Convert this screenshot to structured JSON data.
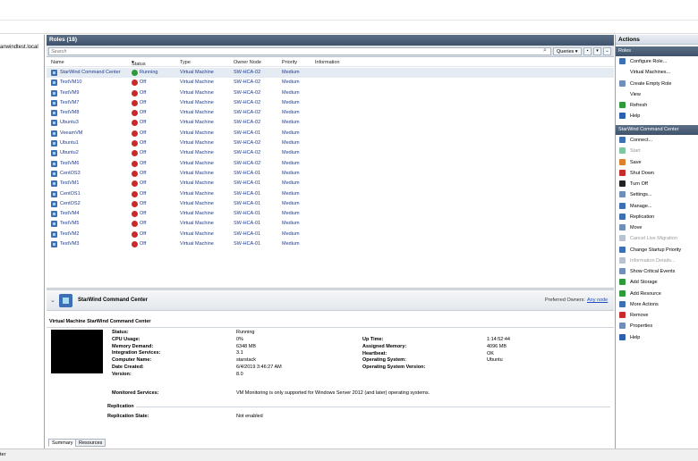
{
  "left": {
    "tree_text": "anwindtest.local"
  },
  "roles": {
    "header": "Roles (18)",
    "search_placeholder": "Search",
    "queries_label": "Queries",
    "columns": [
      "Name",
      "Status",
      "Type",
      "Owner Node",
      "Priority",
      "Information"
    ],
    "rows": [
      {
        "name": "StarWind Command Center",
        "status": "Running",
        "type": "Virtual Machine",
        "owner": "SW-HCA-02",
        "priority": "Medium",
        "state": "run"
      },
      {
        "name": "TestVM10",
        "status": "Off",
        "type": "Virtual Machine",
        "owner": "SW-HCA-02",
        "priority": "Medium",
        "state": "off"
      },
      {
        "name": "TestVM9",
        "status": "Off",
        "type": "Virtual Machine",
        "owner": "SW-HCA-02",
        "priority": "Medium",
        "state": "off"
      },
      {
        "name": "TestVM7",
        "status": "Off",
        "type": "Virtual Machine",
        "owner": "SW-HCA-02",
        "priority": "Medium",
        "state": "off"
      },
      {
        "name": "TestVM8",
        "status": "Off",
        "type": "Virtual Machine",
        "owner": "SW-HCA-02",
        "priority": "Medium",
        "state": "off"
      },
      {
        "name": "Ubuntu3",
        "status": "Off",
        "type": "Virtual Machine",
        "owner": "SW-HCA-02",
        "priority": "Medium",
        "state": "off"
      },
      {
        "name": "VeeamVM",
        "status": "Off",
        "type": "Virtual Machine",
        "owner": "SW-HCA-01",
        "priority": "Medium",
        "state": "off"
      },
      {
        "name": "Ubuntu1",
        "status": "Off",
        "type": "Virtual Machine",
        "owner": "SW-HCA-02",
        "priority": "Medium",
        "state": "off"
      },
      {
        "name": "Ubuntu2",
        "status": "Off",
        "type": "Virtual Machine",
        "owner": "SW-HCA-02",
        "priority": "Medium",
        "state": "off"
      },
      {
        "name": "TestVM6",
        "status": "Off",
        "type": "Virtual Machine",
        "owner": "SW-HCA-02",
        "priority": "Medium",
        "state": "off"
      },
      {
        "name": "CentOS3",
        "status": "Off",
        "type": "Virtual Machine",
        "owner": "SW-HCA-01",
        "priority": "Medium",
        "state": "off"
      },
      {
        "name": "TestVM1",
        "status": "Off",
        "type": "Virtual Machine",
        "owner": "SW-HCA-01",
        "priority": "Medium",
        "state": "off"
      },
      {
        "name": "CentOS1",
        "status": "Off",
        "type": "Virtual Machine",
        "owner": "SW-HCA-01",
        "priority": "Medium",
        "state": "off"
      },
      {
        "name": "CentOS2",
        "status": "Off",
        "type": "Virtual Machine",
        "owner": "SW-HCA-01",
        "priority": "Medium",
        "state": "off"
      },
      {
        "name": "TestVM4",
        "status": "Off",
        "type": "Virtual Machine",
        "owner": "SW-HCA-01",
        "priority": "Medium",
        "state": "off"
      },
      {
        "name": "TestVM5",
        "status": "Off",
        "type": "Virtual Machine",
        "owner": "SW-HCA-01",
        "priority": "Medium",
        "state": "off"
      },
      {
        "name": "TestVM2",
        "status": "Off",
        "type": "Virtual Machine",
        "owner": "SW-HCA-01",
        "priority": "Medium",
        "state": "off"
      },
      {
        "name": "TestVM3",
        "status": "Off",
        "type": "Virtual Machine",
        "owner": "SW-HCA-01",
        "priority": "Medium",
        "state": "off"
      }
    ]
  },
  "details": {
    "title": "StarWind Command Center",
    "preferred_owners_label": "Preferred Owners:",
    "preferred_owners_link": "Any node",
    "vm_title": "Virtual Machine StarWind Command Center",
    "left_fields": [
      {
        "label": "Status:",
        "value": "Running"
      },
      {
        "label": "CPU Usage:",
        "value": "0%"
      },
      {
        "label": "Memory Demand:",
        "value": "6348 MB"
      },
      {
        "label": "Integration Services:",
        "value": "3.1"
      },
      {
        "label": "Computer Name:",
        "value": "starstack"
      },
      {
        "label": "Date Created:",
        "value": "6/4/2019 3:46:27 AM"
      },
      {
        "label": "Version:",
        "value": "8.0"
      }
    ],
    "right_fields": [
      {
        "label": "Up Time:",
        "value": "1:14:52:44"
      },
      {
        "label": "Assigned Memory:",
        "value": "4096 MB"
      },
      {
        "label": "Heartbeat:",
        "value": "OK"
      },
      {
        "label": "Operating System:",
        "value": "Ubuntu"
      },
      {
        "label": "Operating System Version:",
        "value": ""
      }
    ],
    "monitored_label": "Monitored Services:",
    "monitored_value": "VM Monitoring is only supported for Windows Server 2012 (and later) operating systems.",
    "replication_label": "Replication",
    "replication_state_label": "Replication State:",
    "replication_state_value": "Not enabled",
    "tabs": [
      "Summary",
      "Resources"
    ]
  },
  "actions": {
    "header": "Actions",
    "section1": "Roles",
    "section1_items": [
      {
        "label": "Configure Role...",
        "icon": "configure-role-icon",
        "color": "#3c6fb3",
        "disabled": false
      },
      {
        "label": "Virtual Machines...",
        "icon": "",
        "color": "",
        "disabled": false
      },
      {
        "label": "Create Empty Role",
        "icon": "create-role-icon",
        "color": "#6f8fb8",
        "disabled": false
      },
      {
        "label": "View",
        "icon": "",
        "color": "",
        "disabled": false
      },
      {
        "label": "Refresh",
        "icon": "refresh-icon",
        "color": "#2e9b3a",
        "disabled": false
      },
      {
        "label": "Help",
        "icon": "help-icon",
        "color": "#2c5fb0",
        "disabled": false
      }
    ],
    "section2": "StarWind Command Center",
    "section2_items": [
      {
        "label": "Connect...",
        "icon": "connect-icon",
        "color": "#3c6fb3",
        "disabled": false
      },
      {
        "label": "Start",
        "icon": "start-icon",
        "color": "#7fc7a1",
        "disabled": true
      },
      {
        "label": "Save",
        "icon": "save-icon",
        "color": "#d9822b",
        "disabled": false
      },
      {
        "label": "Shut Down",
        "icon": "shutdown-icon",
        "color": "#c92b2b",
        "disabled": false
      },
      {
        "label": "Turn Off",
        "icon": "turn-off-icon",
        "color": "#222222",
        "disabled": false
      },
      {
        "label": "Settings...",
        "icon": "settings-icon",
        "color": "#6f8fb8",
        "disabled": false
      },
      {
        "label": "Manage...",
        "icon": "manage-icon",
        "color": "#3c6fb3",
        "disabled": false
      },
      {
        "label": "Replication",
        "icon": "replication-icon",
        "color": "#3c6fb3",
        "disabled": false
      },
      {
        "label": "Move",
        "icon": "move-icon",
        "color": "#6f8fb8",
        "disabled": false
      },
      {
        "label": "Cancel Live Migration",
        "icon": "cancel-migration-icon",
        "color": "#b8c2ce",
        "disabled": true
      },
      {
        "label": "Change Startup Priority",
        "icon": "startup-priority-icon",
        "color": "#3c6fb3",
        "disabled": false
      },
      {
        "label": "Information Details...",
        "icon": "information-icon",
        "color": "#b8c2ce",
        "disabled": true
      },
      {
        "label": "Show Critical Events",
        "icon": "critical-events-icon",
        "color": "#6f8fb8",
        "disabled": false
      },
      {
        "label": "Add Storage",
        "icon": "add-storage-icon",
        "color": "#2e9b3a",
        "disabled": false
      },
      {
        "label": "Add Resource",
        "icon": "add-resource-icon",
        "color": "#2e9b3a",
        "disabled": false
      },
      {
        "label": "More Actions",
        "icon": "more-actions-icon",
        "color": "#3c6fb3",
        "disabled": false
      },
      {
        "label": "Remove",
        "icon": "remove-icon",
        "color": "#c92b2b",
        "disabled": false
      },
      {
        "label": "Properties",
        "icon": "properties-icon",
        "color": "#6f8fb8",
        "disabled": false
      },
      {
        "label": "Help",
        "icon": "help-icon",
        "color": "#2c5fb0",
        "disabled": false
      }
    ]
  },
  "statusbar": {
    "text": "ter"
  }
}
